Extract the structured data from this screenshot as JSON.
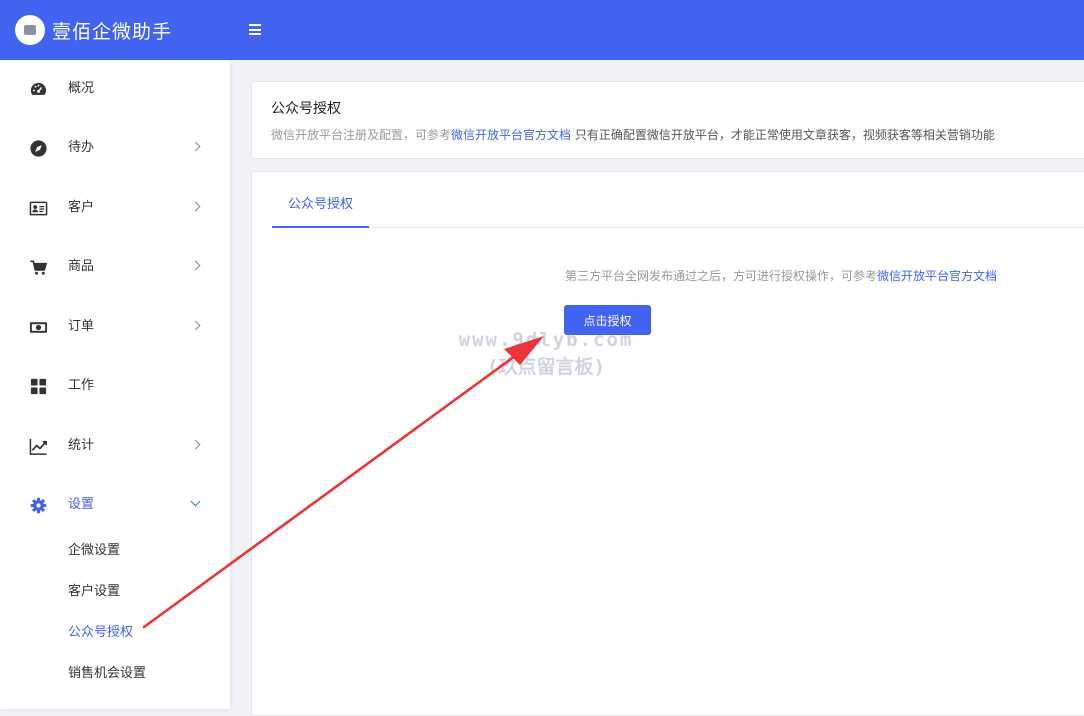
{
  "app": {
    "title": "壹佰企微助手"
  },
  "sidebar": {
    "items": [
      {
        "label": "概况",
        "icon": "dashboard-icon",
        "has_children": false
      },
      {
        "label": "待办",
        "icon": "compass-icon",
        "has_children": true
      },
      {
        "label": "客户",
        "icon": "id-card-icon",
        "has_children": true
      },
      {
        "label": "商品",
        "icon": "cart-icon",
        "has_children": true
      },
      {
        "label": "订单",
        "icon": "money-icon",
        "has_children": true
      },
      {
        "label": "工作",
        "icon": "grid-icon",
        "has_children": false
      },
      {
        "label": "统计",
        "icon": "line-chart-icon",
        "has_children": true
      },
      {
        "label": "设置",
        "icon": "gear-icon",
        "has_children": true,
        "expanded": true
      }
    ],
    "settings_children": [
      "企微设置",
      "客户设置",
      "公众号授权",
      "销售机会设置"
    ],
    "active_child": "公众号授权"
  },
  "page_header": {
    "title": "公众号授权",
    "desc_prefix": "微信开放平台注册及配置，可参考",
    "desc_link": "微信开放平台官方文档",
    "desc_suffix": " 只有正确配置微信开放平台，才能正常使用文章获客，视频获客等相关营销功能"
  },
  "tabs": [
    {
      "label": "公众号授权",
      "active": true
    }
  ],
  "content": {
    "hint_prefix": "第三方平台全网发布通过之后，方可进行授权操作，可参考",
    "hint_link": "微信开放平台官方文档",
    "button_label": "点击授权"
  },
  "watermark": {
    "line1": "www.9dlyb.com",
    "line2": "(玖点留言板)"
  },
  "colors": {
    "primary": "#4262f0",
    "arrow": "#e8363a"
  }
}
